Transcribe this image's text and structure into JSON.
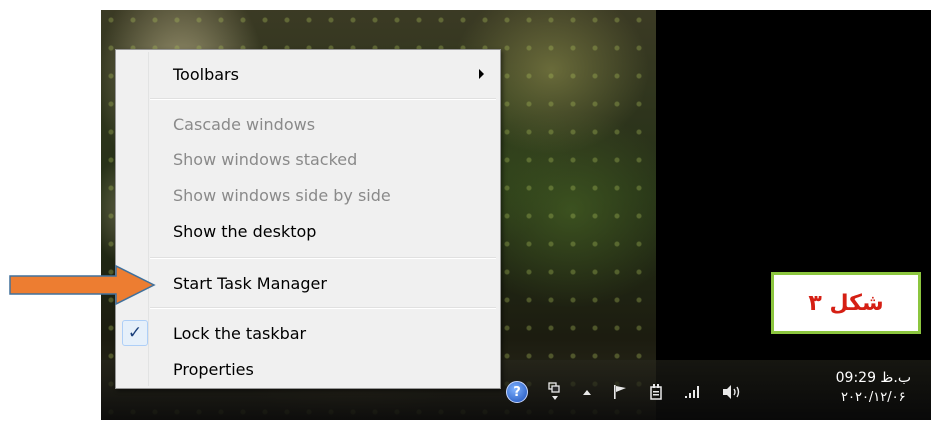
{
  "menu": {
    "items": [
      {
        "label": "Toolbars",
        "enabled": true,
        "has_submenu": true
      },
      {
        "label": "Cascade windows",
        "enabled": false
      },
      {
        "label": "Show windows stacked",
        "enabled": false
      },
      {
        "label": "Show windows side by side",
        "enabled": false
      },
      {
        "label": "Show the desktop",
        "enabled": true
      },
      {
        "label": "Start Task Manager",
        "enabled": true,
        "highlighted_by_arrow": true
      },
      {
        "label": "Lock the taskbar",
        "enabled": true,
        "checked": true
      },
      {
        "label": "Properties",
        "enabled": true
      }
    ],
    "check_glyph": "✓"
  },
  "taskbar": {
    "tray_icons": [
      "help-icon",
      "window-icon",
      "show-hidden-icons-arrow",
      "action-center-flag-icon",
      "power-icon",
      "signal-bars-icon",
      "volume-icon"
    ],
    "help_glyph": "?",
    "clock": {
      "time": "09:29 ب.ظ",
      "date": "۲۰۲۰/۱۲/۰۶"
    }
  },
  "annotation": {
    "label": "شکل ۳",
    "label_color": "#d51f14",
    "label_border_color": "#8cc63f",
    "arrow_fill": "#ed7d31",
    "arrow_stroke": "#41719c"
  }
}
